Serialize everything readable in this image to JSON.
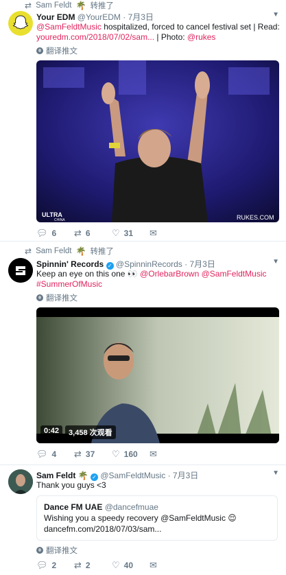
{
  "tweet1": {
    "retweet_line": {
      "user": "Sam Feldt",
      "suffix": "转推了"
    },
    "name": "Your EDM",
    "handle": "@YourEDM",
    "date": "· 7月3日",
    "text_mention": "@SamFeldtMusic",
    "text_main": " hospitalized, forced to cancel festival set | Read:",
    "text_link": "youredm.com/2018/07/02/sam...",
    "text_sep": " | Photo: ",
    "text_photo_handle": "@rukes",
    "translate": "翻译推文",
    "replies": "6",
    "retweets": "6",
    "likes": "31",
    "media_watermark_left": "ULTRA",
    "media_watermark_left2": "CHINA",
    "media_watermark_right": "RUKES.COM"
  },
  "tweet2": {
    "retweet_line": {
      "user": "Sam Feldt",
      "suffix": "转推了"
    },
    "name": "Spinnin' Records",
    "handle": "@SpinninRecords",
    "date": "· 7月3日",
    "text_main": "Keep an eye on this one 👀 ",
    "mention1": "@OrlebarBrown",
    "mention2": "@SamFeldtMusic",
    "hashtag": "#SummerOfMusic",
    "translate": "翻译推文",
    "video_duration": "0:42",
    "video_views": "3,458 次观看",
    "replies": "4",
    "retweets": "37",
    "likes": "160"
  },
  "tweet3": {
    "name": "Sam Feldt",
    "handle": "@SamFeldtMusic",
    "date": "· 7月3日",
    "text": "Thank you guys <3",
    "quote": {
      "name": "Dance FM UAE",
      "handle": "@dancefmuae",
      "text": "Wishing you a speedy recovery @SamFeldtMusic 😌",
      "link": "dancefm.com/2018/07/03/sam..."
    },
    "translate": "翻译推文",
    "replies": "2",
    "retweets": "2",
    "likes": "40"
  },
  "colors": {
    "accent": "#e0245e",
    "muted": "#657786",
    "verified": "#1da1f2"
  }
}
